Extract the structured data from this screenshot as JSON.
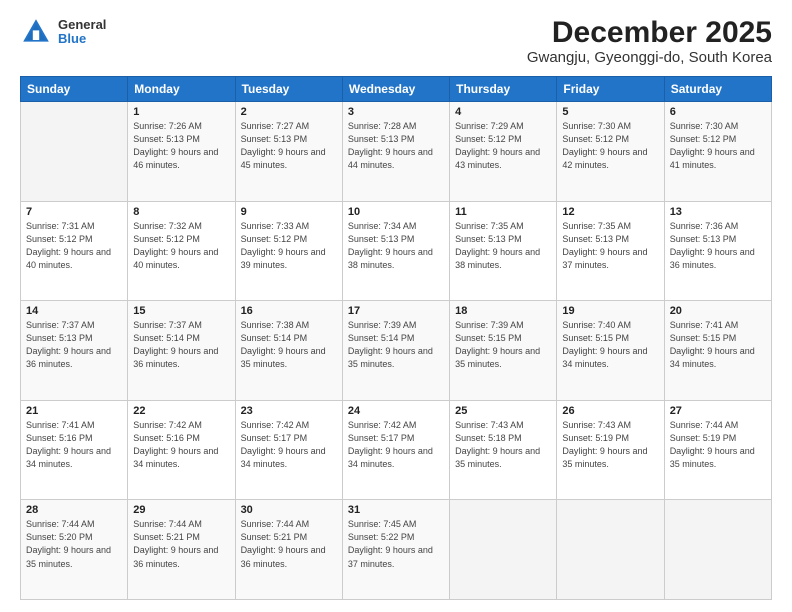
{
  "header": {
    "logo_general": "General",
    "logo_blue": "Blue",
    "title": "December 2025",
    "subtitle": "Gwangju, Gyeonggi-do, South Korea"
  },
  "weekdays": [
    "Sunday",
    "Monday",
    "Tuesday",
    "Wednesday",
    "Thursday",
    "Friday",
    "Saturday"
  ],
  "weeks": [
    [
      {
        "day": "",
        "sunrise": "",
        "sunset": "",
        "daylight": ""
      },
      {
        "day": "1",
        "sunrise": "Sunrise: 7:26 AM",
        "sunset": "Sunset: 5:13 PM",
        "daylight": "Daylight: 9 hours and 46 minutes."
      },
      {
        "day": "2",
        "sunrise": "Sunrise: 7:27 AM",
        "sunset": "Sunset: 5:13 PM",
        "daylight": "Daylight: 9 hours and 45 minutes."
      },
      {
        "day": "3",
        "sunrise": "Sunrise: 7:28 AM",
        "sunset": "Sunset: 5:13 PM",
        "daylight": "Daylight: 9 hours and 44 minutes."
      },
      {
        "day": "4",
        "sunrise": "Sunrise: 7:29 AM",
        "sunset": "Sunset: 5:12 PM",
        "daylight": "Daylight: 9 hours and 43 minutes."
      },
      {
        "day": "5",
        "sunrise": "Sunrise: 7:30 AM",
        "sunset": "Sunset: 5:12 PM",
        "daylight": "Daylight: 9 hours and 42 minutes."
      },
      {
        "day": "6",
        "sunrise": "Sunrise: 7:30 AM",
        "sunset": "Sunset: 5:12 PM",
        "daylight": "Daylight: 9 hours and 41 minutes."
      }
    ],
    [
      {
        "day": "7",
        "sunrise": "Sunrise: 7:31 AM",
        "sunset": "Sunset: 5:12 PM",
        "daylight": "Daylight: 9 hours and 40 minutes."
      },
      {
        "day": "8",
        "sunrise": "Sunrise: 7:32 AM",
        "sunset": "Sunset: 5:12 PM",
        "daylight": "Daylight: 9 hours and 40 minutes."
      },
      {
        "day": "9",
        "sunrise": "Sunrise: 7:33 AM",
        "sunset": "Sunset: 5:12 PM",
        "daylight": "Daylight: 9 hours and 39 minutes."
      },
      {
        "day": "10",
        "sunrise": "Sunrise: 7:34 AM",
        "sunset": "Sunset: 5:13 PM",
        "daylight": "Daylight: 9 hours and 38 minutes."
      },
      {
        "day": "11",
        "sunrise": "Sunrise: 7:35 AM",
        "sunset": "Sunset: 5:13 PM",
        "daylight": "Daylight: 9 hours and 38 minutes."
      },
      {
        "day": "12",
        "sunrise": "Sunrise: 7:35 AM",
        "sunset": "Sunset: 5:13 PM",
        "daylight": "Daylight: 9 hours and 37 minutes."
      },
      {
        "day": "13",
        "sunrise": "Sunrise: 7:36 AM",
        "sunset": "Sunset: 5:13 PM",
        "daylight": "Daylight: 9 hours and 36 minutes."
      }
    ],
    [
      {
        "day": "14",
        "sunrise": "Sunrise: 7:37 AM",
        "sunset": "Sunset: 5:13 PM",
        "daylight": "Daylight: 9 hours and 36 minutes."
      },
      {
        "day": "15",
        "sunrise": "Sunrise: 7:37 AM",
        "sunset": "Sunset: 5:14 PM",
        "daylight": "Daylight: 9 hours and 36 minutes."
      },
      {
        "day": "16",
        "sunrise": "Sunrise: 7:38 AM",
        "sunset": "Sunset: 5:14 PM",
        "daylight": "Daylight: 9 hours and 35 minutes."
      },
      {
        "day": "17",
        "sunrise": "Sunrise: 7:39 AM",
        "sunset": "Sunset: 5:14 PM",
        "daylight": "Daylight: 9 hours and 35 minutes."
      },
      {
        "day": "18",
        "sunrise": "Sunrise: 7:39 AM",
        "sunset": "Sunset: 5:15 PM",
        "daylight": "Daylight: 9 hours and 35 minutes."
      },
      {
        "day": "19",
        "sunrise": "Sunrise: 7:40 AM",
        "sunset": "Sunset: 5:15 PM",
        "daylight": "Daylight: 9 hours and 34 minutes."
      },
      {
        "day": "20",
        "sunrise": "Sunrise: 7:41 AM",
        "sunset": "Sunset: 5:15 PM",
        "daylight": "Daylight: 9 hours and 34 minutes."
      }
    ],
    [
      {
        "day": "21",
        "sunrise": "Sunrise: 7:41 AM",
        "sunset": "Sunset: 5:16 PM",
        "daylight": "Daylight: 9 hours and 34 minutes."
      },
      {
        "day": "22",
        "sunrise": "Sunrise: 7:42 AM",
        "sunset": "Sunset: 5:16 PM",
        "daylight": "Daylight: 9 hours and 34 minutes."
      },
      {
        "day": "23",
        "sunrise": "Sunrise: 7:42 AM",
        "sunset": "Sunset: 5:17 PM",
        "daylight": "Daylight: 9 hours and 34 minutes."
      },
      {
        "day": "24",
        "sunrise": "Sunrise: 7:42 AM",
        "sunset": "Sunset: 5:17 PM",
        "daylight": "Daylight: 9 hours and 34 minutes."
      },
      {
        "day": "25",
        "sunrise": "Sunrise: 7:43 AM",
        "sunset": "Sunset: 5:18 PM",
        "daylight": "Daylight: 9 hours and 35 minutes."
      },
      {
        "day": "26",
        "sunrise": "Sunrise: 7:43 AM",
        "sunset": "Sunset: 5:19 PM",
        "daylight": "Daylight: 9 hours and 35 minutes."
      },
      {
        "day": "27",
        "sunrise": "Sunrise: 7:44 AM",
        "sunset": "Sunset: 5:19 PM",
        "daylight": "Daylight: 9 hours and 35 minutes."
      }
    ],
    [
      {
        "day": "28",
        "sunrise": "Sunrise: 7:44 AM",
        "sunset": "Sunset: 5:20 PM",
        "daylight": "Daylight: 9 hours and 35 minutes."
      },
      {
        "day": "29",
        "sunrise": "Sunrise: 7:44 AM",
        "sunset": "Sunset: 5:21 PM",
        "daylight": "Daylight: 9 hours and 36 minutes."
      },
      {
        "day": "30",
        "sunrise": "Sunrise: 7:44 AM",
        "sunset": "Sunset: 5:21 PM",
        "daylight": "Daylight: 9 hours and 36 minutes."
      },
      {
        "day": "31",
        "sunrise": "Sunrise: 7:45 AM",
        "sunset": "Sunset: 5:22 PM",
        "daylight": "Daylight: 9 hours and 37 minutes."
      },
      {
        "day": "",
        "sunrise": "",
        "sunset": "",
        "daylight": ""
      },
      {
        "day": "",
        "sunrise": "",
        "sunset": "",
        "daylight": ""
      },
      {
        "day": "",
        "sunrise": "",
        "sunset": "",
        "daylight": ""
      }
    ]
  ]
}
